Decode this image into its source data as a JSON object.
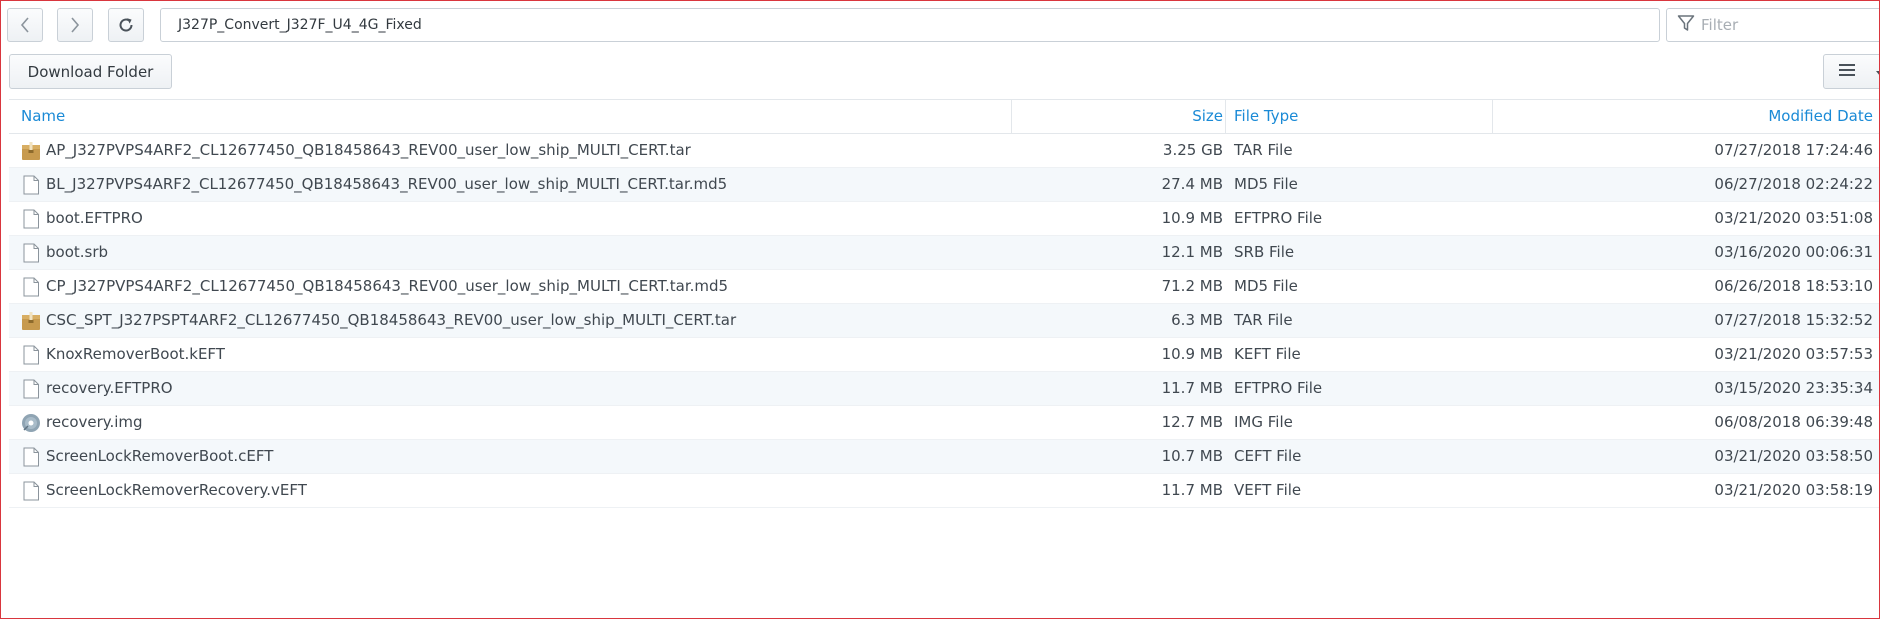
{
  "toolbar": {
    "back_icon": "chevron-left-icon",
    "forward_icon": "chevron-right-icon",
    "refresh_icon": "refresh-icon",
    "path": "J327P_Convert_J327F_U4_4G_Fixed",
    "filter_placeholder": "Filter",
    "filter_icon": "filter-icon"
  },
  "actions": {
    "download_label": "Download Folder",
    "view_icon": "list-view-icon",
    "view_caret_icon": "caret-down-icon"
  },
  "table": {
    "columns": {
      "name": "Name",
      "size": "Size",
      "type": "File Type",
      "modified": "Modified Date"
    },
    "rows": [
      {
        "name": "AP_J327PVPS4ARF2_CL12677450_QB18458643_REV00_user_low_ship_MULTI_CERT.tar",
        "size": "3.25 GB",
        "type": "TAR File",
        "modified": "07/27/2018 17:24:46",
        "icon": "archive-icon"
      },
      {
        "name": "BL_J327PVPS4ARF2_CL12677450_QB18458643_REV00_user_low_ship_MULTI_CERT.tar.md5",
        "size": "27.4 MB",
        "type": "MD5 File",
        "modified": "06/27/2018 02:24:22",
        "icon": "file-icon"
      },
      {
        "name": "boot.EFTPRO",
        "size": "10.9 MB",
        "type": "EFTPRO File",
        "modified": "03/21/2020 03:51:08",
        "icon": "file-icon"
      },
      {
        "name": "boot.srb",
        "size": "12.1 MB",
        "type": "SRB File",
        "modified": "03/16/2020 00:06:31",
        "icon": "file-icon"
      },
      {
        "name": "CP_J327PVPS4ARF2_CL12677450_QB18458643_REV00_user_low_ship_MULTI_CERT.tar.md5",
        "size": "71.2 MB",
        "type": "MD5 File",
        "modified": "06/26/2018 18:53:10",
        "icon": "file-icon"
      },
      {
        "name": "CSC_SPT_J327PSPT4ARF2_CL12677450_QB18458643_REV00_user_low_ship_MULTI_CERT.tar",
        "size": "6.3 MB",
        "type": "TAR File",
        "modified": "07/27/2018 15:32:52",
        "icon": "archive-icon"
      },
      {
        "name": "KnoxRemoverBoot.kEFT",
        "size": "10.9 MB",
        "type": "KEFT File",
        "modified": "03/21/2020 03:57:53",
        "icon": "file-icon"
      },
      {
        "name": "recovery.EFTPRO",
        "size": "11.7 MB",
        "type": "EFTPRO File",
        "modified": "03/15/2020 23:35:34",
        "icon": "file-icon"
      },
      {
        "name": "recovery.img",
        "size": "12.7 MB",
        "type": "IMG File",
        "modified": "06/08/2018 06:39:48",
        "icon": "disc-image-icon"
      },
      {
        "name": "ScreenLockRemoverBoot.cEFT",
        "size": "10.7 MB",
        "type": "CEFT File",
        "modified": "03/21/2020 03:58:50",
        "icon": "file-icon"
      },
      {
        "name": "ScreenLockRemoverRecovery.vEFT",
        "size": "11.7 MB",
        "type": "VEFT File",
        "modified": "03/21/2020 03:58:19",
        "icon": "file-icon"
      }
    ]
  },
  "colors": {
    "accent": "#1a8ad6",
    "alt_row": "#f4f8fb",
    "frame_border": "#d9363e"
  }
}
